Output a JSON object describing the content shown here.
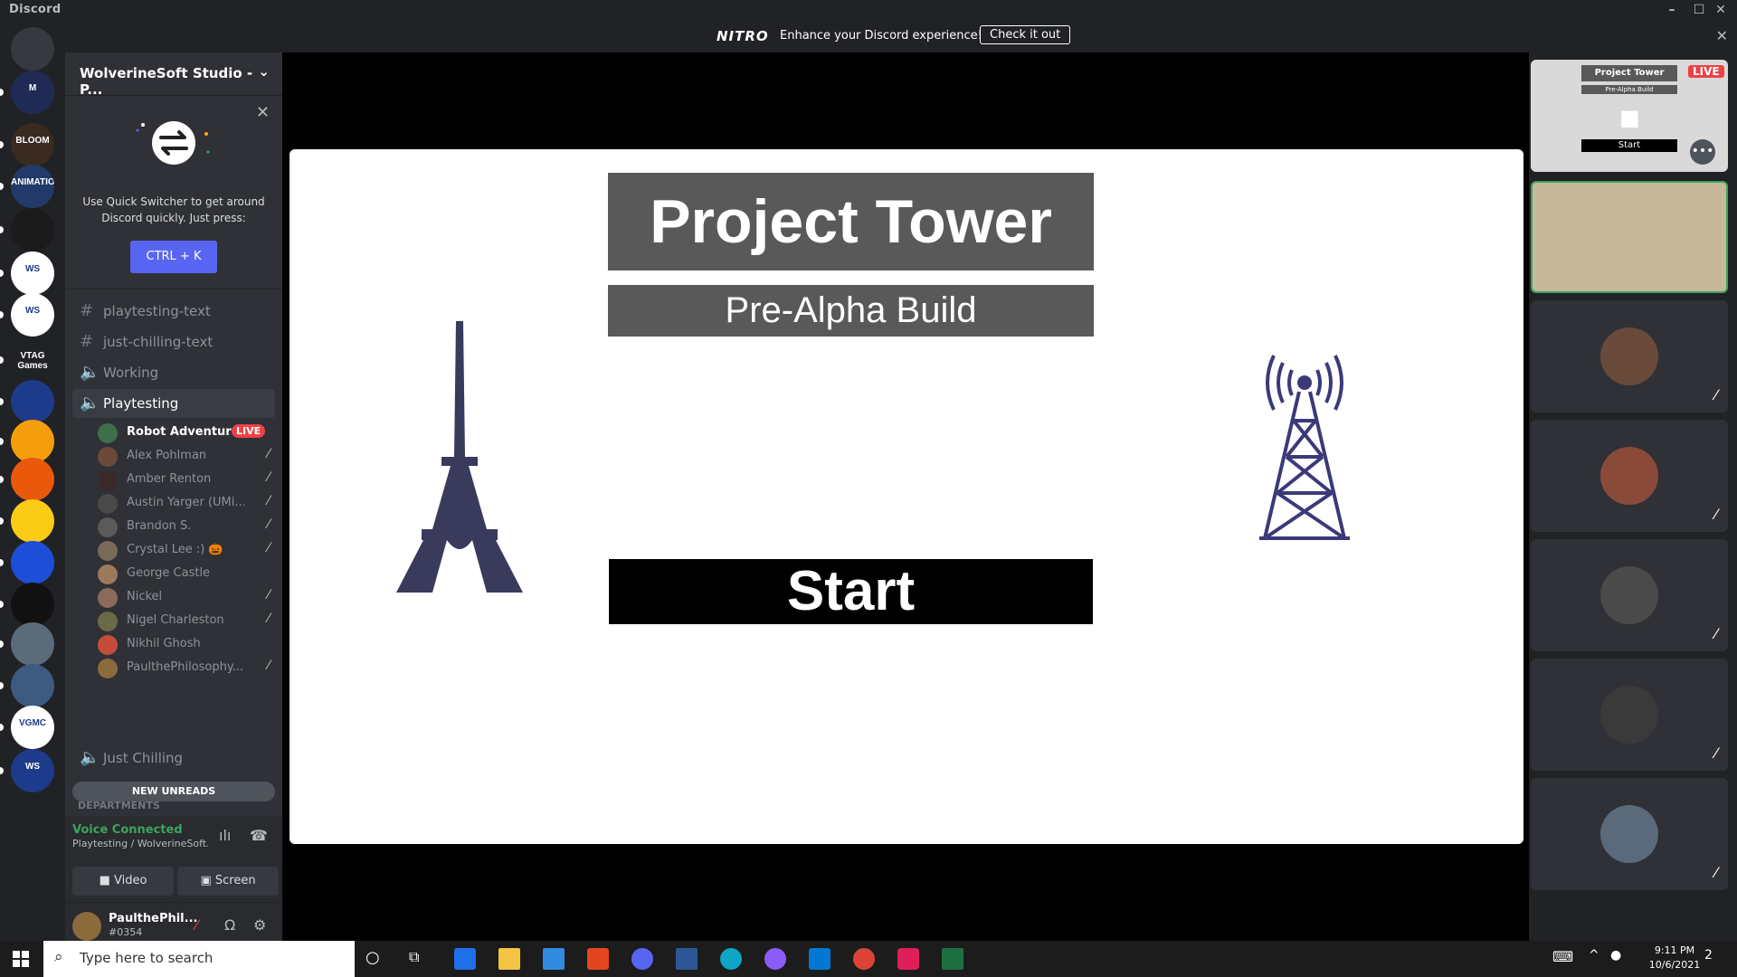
{
  "window": {
    "app_title": "Discord"
  },
  "nitro_banner": {
    "logo": "NITRO",
    "message": "Enhance your Discord experience!",
    "cta": "Check it out"
  },
  "server": {
    "name": "WolverineSoft Studio - P..."
  },
  "quick_switcher": {
    "description": "Use Quick Switcher to get around Discord quickly. Just press:",
    "shortcut": "CTRL + K"
  },
  "rail": {
    "guilds": [
      {
        "label": "",
        "color": "#36393f"
      },
      {
        "label": "M",
        "color": "#1f2b55"
      },
      {
        "label": "BLOOM",
        "color": "#3a2a20"
      },
      {
        "label": "ANIMATION",
        "color": "#223a6a"
      },
      {
        "label": "",
        "color": "#1b1b1b"
      },
      {
        "label": "WS",
        "color": "#ffffff"
      },
      {
        "label": "WS",
        "color": "#ffffff"
      },
      {
        "label": "VTAG Games",
        "color": "#202225"
      },
      {
        "label": "",
        "color": "#1e3a8a"
      },
      {
        "label": "",
        "color": "#f59e0b"
      },
      {
        "label": "",
        "color": "#ea580c"
      },
      {
        "label": "",
        "color": "#facc15"
      },
      {
        "label": "",
        "color": "#1d4ed8"
      },
      {
        "label": "",
        "color": "#111111"
      },
      {
        "label": "",
        "color": "#5b6b7a"
      },
      {
        "label": "",
        "color": "#3d5a80"
      },
      {
        "label": "VGMC",
        "color": "#ffffff"
      },
      {
        "label": "WS",
        "color": "#1e3a8a"
      }
    ]
  },
  "channels": {
    "text": [
      {
        "name": "playtesting-text"
      },
      {
        "name": "just-chilling-text"
      }
    ],
    "voice_working": "Working",
    "voice_playtesting": "Playtesting",
    "voice_just_chilling": "Just Chilling",
    "category_hint": "DEPARTMENTS",
    "new_unreads": "NEW UNREADS"
  },
  "voice_users": [
    {
      "name": "Robot Adventure",
      "live": true,
      "color": "#3e6e4a"
    },
    {
      "name": "Alex Pohlman",
      "color": "#6b4a3a"
    },
    {
      "name": "Amber Renton",
      "color": "#3a2a2a"
    },
    {
      "name": "Austin Yarger (UMi...",
      "color": "#4a4a4a"
    },
    {
      "name": "Brandon S.",
      "color": "#5a5a5a"
    },
    {
      "name": "Crystal Lee :) 🎃",
      "color": "#7a6a5a"
    },
    {
      "name": "George Castle",
      "color": "#9a7a5a"
    },
    {
      "name": "Nickel",
      "color": "#8a6a5a"
    },
    {
      "name": "Nigel Charleston",
      "color": "#6a6a4a"
    },
    {
      "name": "Nikhil Ghosh",
      "color": "#c44d3a"
    },
    {
      "name": "PaulthePhilosophy...",
      "color": "#8b6a3c"
    }
  ],
  "live_badge": "LIVE",
  "voice_panel": {
    "status": "Voice Connected",
    "channel": "Playtesting / WolverineSoft...",
    "video": "Video",
    "screen": "Screen"
  },
  "user_panel": {
    "name": "PaulthePhil...",
    "tag": "#0354"
  },
  "stream": {
    "title": "Project Tower",
    "subtitle": "Pre-Alpha Build",
    "start": "Start"
  },
  "preview_tile": {
    "title": "Project Tower",
    "subtitle": "Pre-Alpha Build",
    "start": "Start",
    "live": "LIVE"
  },
  "participants": [
    {
      "color": "#c8b89a",
      "speaking": true,
      "bg": "#c8b89a"
    },
    {
      "color": "#6a4a3a",
      "bg": "#2f3136"
    },
    {
      "color": "#8a4a3a",
      "bg": "#2f3136"
    },
    {
      "color": "#4a4a4a",
      "bg": "#2f3136"
    },
    {
      "color": "#3a3a3a",
      "bg": "#2f3136"
    },
    {
      "color": "#5a6a7a",
      "bg": "#2f3136"
    }
  ],
  "taskbar": {
    "search_placeholder": "Type here to search",
    "time": "9:11 PM",
    "date": "10/6/2021",
    "notifications": "2"
  }
}
